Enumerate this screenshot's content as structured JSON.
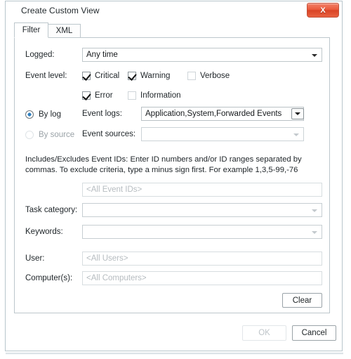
{
  "window": {
    "title": "Create Custom View",
    "close_label": "X",
    "close_icon": "close-icon",
    "close_color": "#e0522f"
  },
  "tabs": [
    {
      "label": "Filter",
      "selected": true
    },
    {
      "label": "XML",
      "selected": false
    }
  ],
  "filter": {
    "logged": {
      "label": "Logged:",
      "value": "Any time"
    },
    "event_level": {
      "label": "Event level:",
      "options": [
        {
          "label": "Critical",
          "checked": true
        },
        {
          "label": "Warning",
          "checked": true
        },
        {
          "label": "Verbose",
          "checked": false
        },
        {
          "label": "Error",
          "checked": true
        },
        {
          "label": "Information",
          "checked": false
        }
      ]
    },
    "source_mode": {
      "by_log": {
        "label": "By log",
        "selected": true
      },
      "by_source": {
        "label": "By source",
        "selected": false
      }
    },
    "event_logs": {
      "label": "Event logs:",
      "value": "Application,System,Forwarded Events"
    },
    "event_sources": {
      "label": "Event sources:",
      "value": ""
    },
    "event_ids": {
      "helper_text": "Includes/Excludes Event IDs: Enter ID numbers and/or ID ranges separated by commas. To exclude criteria, type a minus sign first. For example 1,3,5-99,-76",
      "placeholder": "<All Event IDs>",
      "value": ""
    },
    "task_category": {
      "label": "Task category:",
      "value": ""
    },
    "keywords": {
      "label": "Keywords:",
      "value": ""
    },
    "user": {
      "label": "User:",
      "placeholder": "<All Users>",
      "value": ""
    },
    "computers": {
      "label": "Computer(s):",
      "placeholder": "<All Computers>",
      "value": ""
    },
    "clear_button": "Clear"
  },
  "footer": {
    "ok_label": "OK",
    "ok_enabled": false,
    "cancel_label": "Cancel",
    "cancel_enabled": true
  }
}
